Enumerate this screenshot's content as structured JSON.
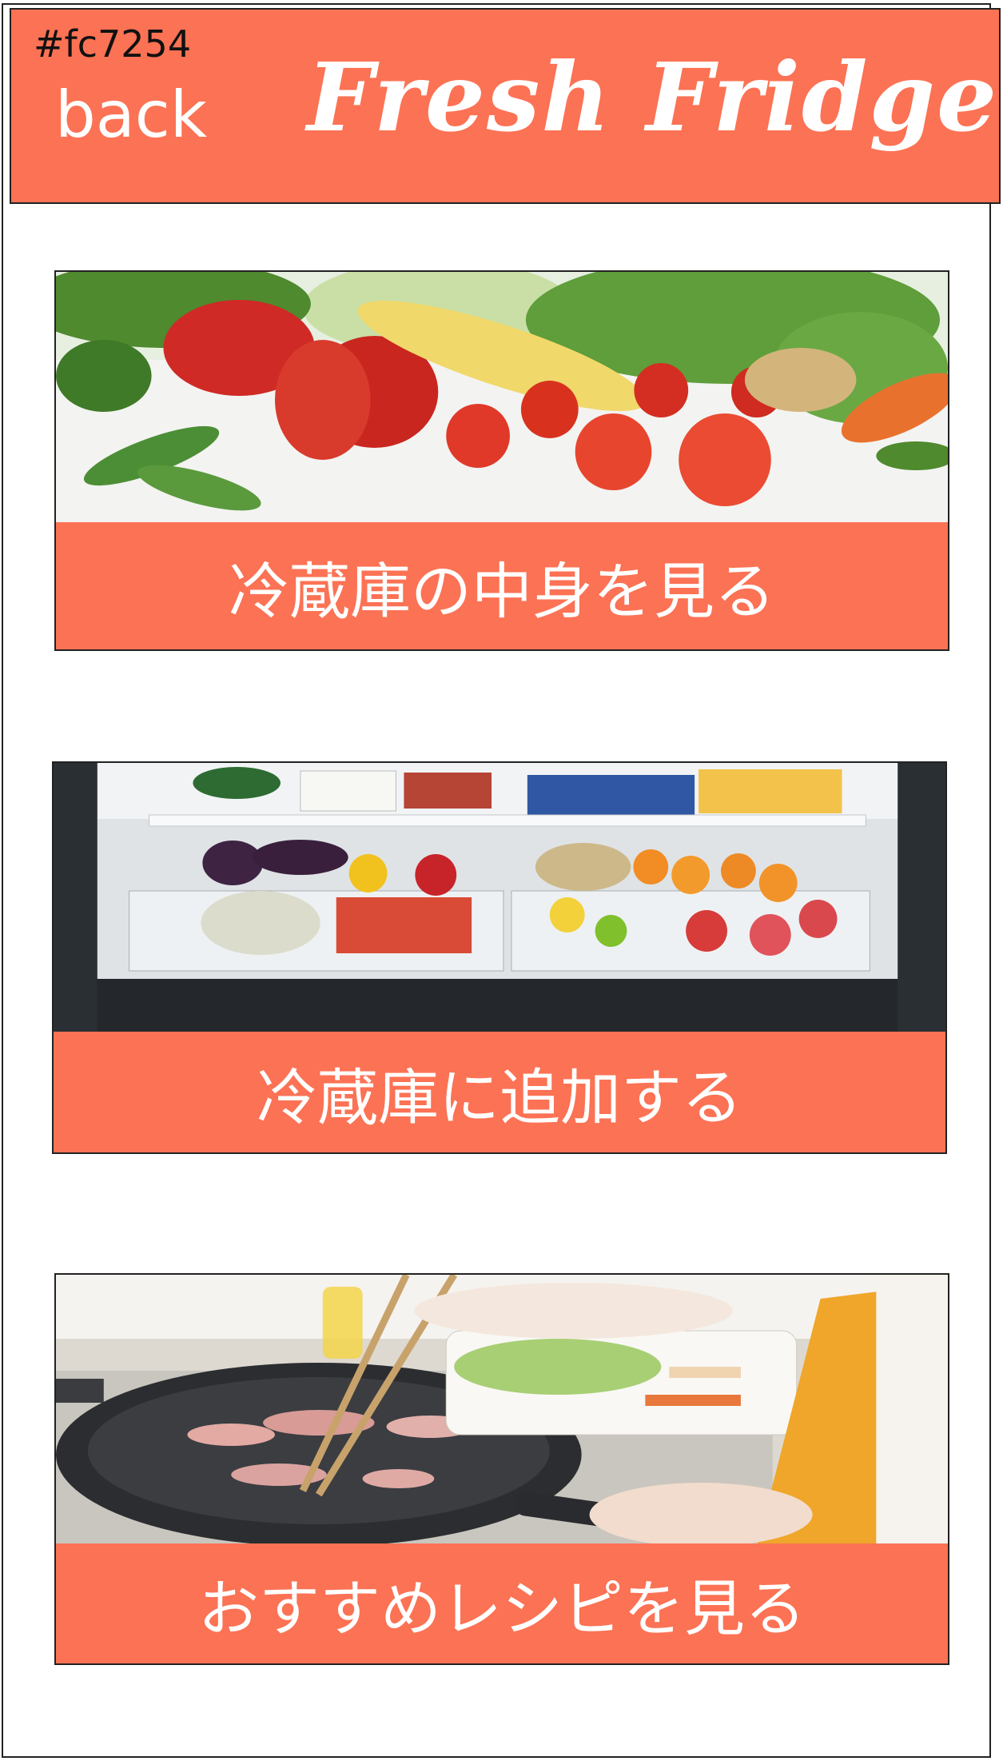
{
  "header": {
    "hex_note": "#fc7254",
    "back_label": "back",
    "title": "Fresh Fridge",
    "color": "#fc7254"
  },
  "cards": [
    {
      "image_icon": "vegetables-photo",
      "label": "冷蔵庫の中身を見る"
    },
    {
      "image_icon": "fridge-drawers-photo",
      "label": "冷蔵庫に追加する"
    },
    {
      "image_icon": "cooking-photo",
      "label": "おすすめレシピを見る"
    }
  ]
}
